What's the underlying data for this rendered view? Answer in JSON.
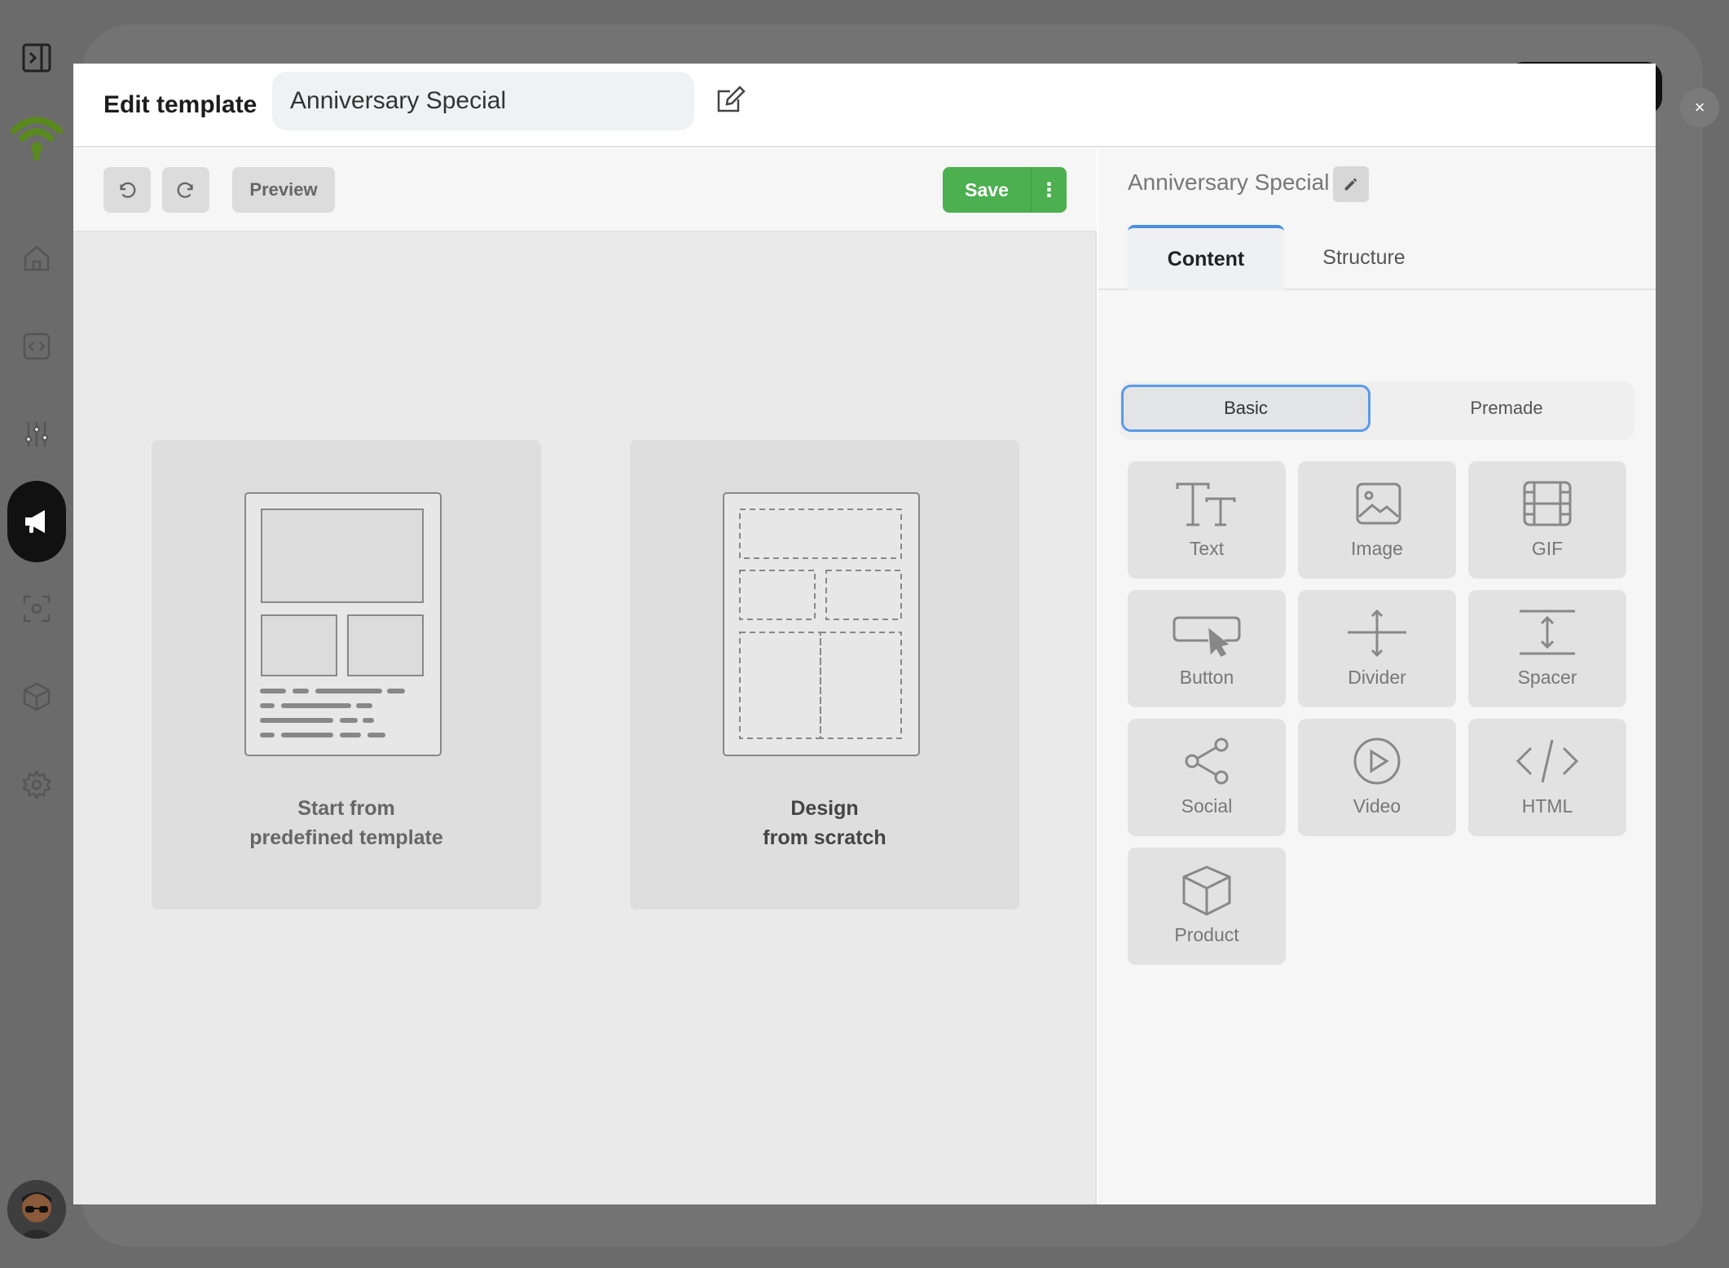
{
  "modal": {
    "title": "Edit template",
    "template_name": "Anniversary Special",
    "close_label": "×"
  },
  "toolbar": {
    "preview_label": "Preview",
    "save_label": "Save",
    "more_label": "⋮"
  },
  "canvas": {
    "cards": [
      {
        "line1": "Start from",
        "line2": "predefined template"
      },
      {
        "line1": "Design",
        "line2": "from scratch"
      }
    ]
  },
  "panel": {
    "title": "Anniversary Special",
    "tabs": [
      {
        "label": "Content"
      },
      {
        "label": "Structure"
      }
    ],
    "segments": [
      {
        "label": "Basic"
      },
      {
        "label": "Premade"
      }
    ],
    "blocks": [
      {
        "label": "Text",
        "icon": "text-icon"
      },
      {
        "label": "Image",
        "icon": "image-icon"
      },
      {
        "label": "GIF",
        "icon": "gif-icon"
      },
      {
        "label": "Button",
        "icon": "button-icon"
      },
      {
        "label": "Divider",
        "icon": "divider-icon"
      },
      {
        "label": "Spacer",
        "icon": "spacer-icon"
      },
      {
        "label": "Social",
        "icon": "social-icon"
      },
      {
        "label": "Video",
        "icon": "video-icon"
      },
      {
        "label": "HTML",
        "icon": "html-icon"
      },
      {
        "label": "Product",
        "icon": "product-icon"
      }
    ]
  },
  "colors": {
    "accent_green": "#4caf50",
    "accent_blue": "#4a90e2",
    "logo_green": "#5a8a1e"
  }
}
